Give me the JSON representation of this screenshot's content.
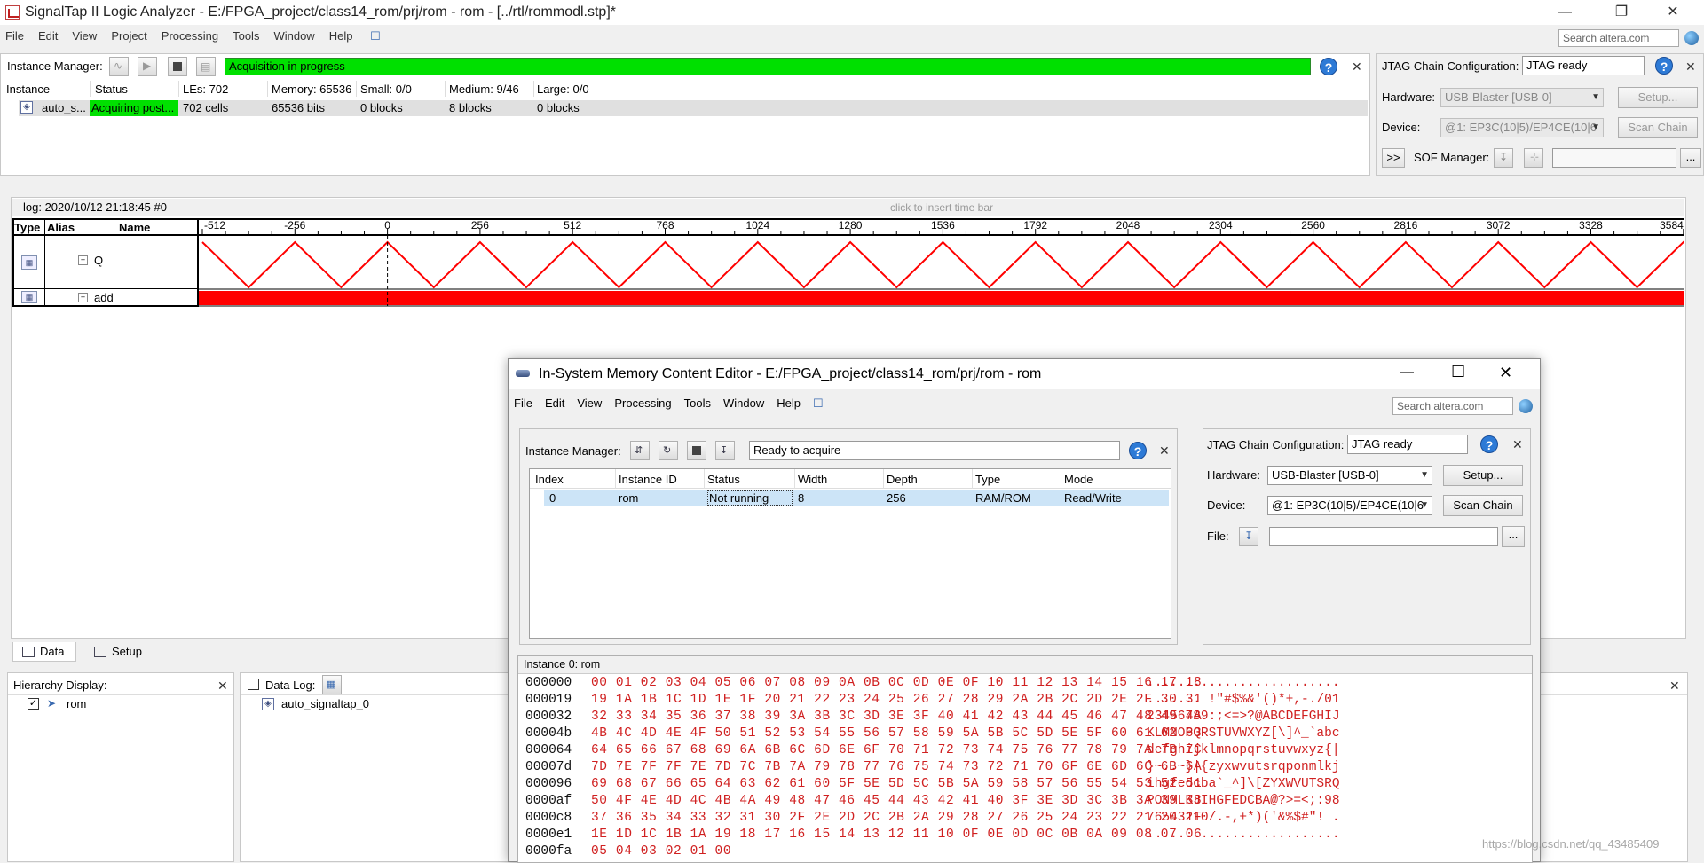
{
  "window": {
    "title": "SignalTap II Logic Analyzer - E:/FPGA_project/class14_rom/prj/rom - rom - [../rtl/rommodl.stp]*",
    "search_placeholder": "Search altera.com",
    "minimize": "—",
    "restore": "❐",
    "close": "✕"
  },
  "menu": [
    "File",
    "Edit",
    "View",
    "Project",
    "Processing",
    "Tools",
    "Window",
    "Help"
  ],
  "instance_manager": {
    "label": "Instance Manager:",
    "status": "Acquisition in progress",
    "columns": [
      "Instance",
      "Status",
      "LEs: 702",
      "Memory: 65536",
      "Small: 0/0",
      "Medium: 9/46",
      "Large: 0/0"
    ],
    "row": [
      "auto_s...",
      "Acquiring post...",
      "702 cells",
      "65536 bits",
      "0 blocks",
      "8 blocks",
      "0 blocks"
    ],
    "status_color": "#00e000"
  },
  "jtag_top": {
    "label": "JTAG Chain Configuration:",
    "status": "JTAG ready",
    "hardware_label": "Hardware:",
    "hardware_value": "USB-Blaster [USB-0]",
    "setup_label": "Setup...",
    "device_label": "Device:",
    "device_value": "@1: EP3C(10|5)/EP4CE(10|6",
    "scan_label": "Scan Chain",
    "expand_label": ">>",
    "sof_label": "SOF Manager:",
    "browse_label": "..."
  },
  "waveform": {
    "log_label": "log: 2020/10/12 21:18:45  #0",
    "insert_hint": "click to insert time bar",
    "col_type": "Type",
    "col_alias": "Alias",
    "col_name": "Name",
    "ticks": [
      "-512",
      "-256",
      "0",
      "256",
      "512",
      "768",
      "1024",
      "1280",
      "1536",
      "1792",
      "2048",
      "2304",
      "2560",
      "2816",
      "3072",
      "3328",
      "3584"
    ],
    "signals": [
      "Q",
      "add"
    ],
    "expander": "+",
    "signal_color": "#ff0000"
  },
  "bottom_tabs": [
    "Data",
    "Setup"
  ],
  "hierarchy": {
    "label": "Hierarchy Display:",
    "item": "rom"
  },
  "datalog": {
    "label": "Data Log:",
    "item": "auto_signaltap_0"
  },
  "mce": {
    "title": "In-System Memory Content Editor - E:/FPGA_project/class14_rom/prj/rom - rom",
    "menu": [
      "File",
      "Edit",
      "View",
      "Processing",
      "Tools",
      "Window",
      "Help"
    ],
    "search_placeholder": "Search altera.com",
    "minimize": "—",
    "maximize": "☐",
    "close": "✕",
    "instance_manager_label": "Instance Manager:",
    "status": "Ready to acquire",
    "columns": [
      "Index",
      "Instance ID",
      "Status",
      "Width",
      "Depth",
      "Type",
      "Mode"
    ],
    "row": [
      "0",
      "rom",
      "Not running",
      "8",
      "256",
      "RAM/ROM",
      "Read/Write"
    ],
    "jtag_label": "JTAG Chain Configuration:",
    "jtag_status": "JTAG ready",
    "hardware_label": "Hardware:",
    "hardware_value": "USB-Blaster [USB-0]",
    "setup_label": "Setup...",
    "device_label": "Device:",
    "device_value": "@1: EP3C(10|5)/EP4CE(10|6",
    "scan_label": "Scan Chain",
    "file_label": "File:",
    "browse_label": "...",
    "hex_title": "Instance 0: rom",
    "hex_rows": [
      {
        "addr": "000000",
        "bytes": "00 01 02 03 04 05 06 07 08 09 0A 0B 0C 0D 0E 0F 10 11 12 13 14 15 16 17 18",
        "ascii": "........................."
      },
      {
        "addr": "000019",
        "bytes": "19 1A 1B 1C 1D 1E 1F 20 21 22 23 24 25 26 27 28 29 2A 2B 2C 2D 2E 2F 30 31",
        "ascii": "....... !\"#$%&'()*+,-./01"
      },
      {
        "addr": "000032",
        "bytes": "32 33 34 35 36 37 38 39 3A 3B 3C 3D 3E 3F 40 41 42 43 44 45 46 47 48 49 4A",
        "ascii": "23456789:;<=>?@ABCDEFGHIJ"
      },
      {
        "addr": "00004b",
        "bytes": "4B 4C 4D 4E 4F 50 51 52 53 54 55 56 57 58 59 5A 5B 5C 5D 5E 5F 60 61 62 63",
        "ascii": "KLMNOPQRSTUVWXYZ[\\]^_`abc"
      },
      {
        "addr": "000064",
        "bytes": "64 65 66 67 68 69 6A 6B 6C 6D 6E 6F 70 71 72 73 74 75 76 77 78 79 7A 7B 7C",
        "ascii": "defghijklmnopqrstuvwxyz{|"
      },
      {
        "addr": "00007d",
        "bytes": "7D 7E 7F 7F 7E 7D 7C 7B 7A 79 78 77 76 75 74 73 72 71 70 6F 6E 6D 6C 6B 6A",
        "ascii": "}~..~}|{zyxwvutsrqponmlkj"
      },
      {
        "addr": "000096",
        "bytes": "69 68 67 66 65 64 63 62 61 60 5F 5E 5D 5C 5B 5A 59 58 57 56 55 54 53 52 51",
        "ascii": "ihgfedcba`_^]\\[ZYXWVUTSRQ"
      },
      {
        "addr": "0000af",
        "bytes": "50 4F 4E 4D 4C 4B 4A 49 48 47 46 45 44 43 42 41 40 3F 3E 3D 3C 3B 3A 39 38",
        "ascii": "PONMLKJIHGFEDCBA@?>=<;:98"
      },
      {
        "addr": "0000c8",
        "bytes": "37 36 35 34 33 32 31 30 2F 2E 2D 2C 2B 2A 29 28 27 26 25 24 23 22 21 20 1F",
        "ascii": "76543210/.-,+*)('&%$#\"! ."
      },
      {
        "addr": "0000e1",
        "bytes": "1E 1D 1C 1B 1A 19 18 17 16 15 14 13 12 11 10 0F 0E 0D 0C 0B 0A 09 08 07 06",
        "ascii": "........................."
      },
      {
        "addr": "0000fa",
        "bytes": "05 04 03 02 01 00",
        "ascii": ""
      }
    ]
  },
  "watermark": "https://blog.csdn.net/qq_43485409"
}
